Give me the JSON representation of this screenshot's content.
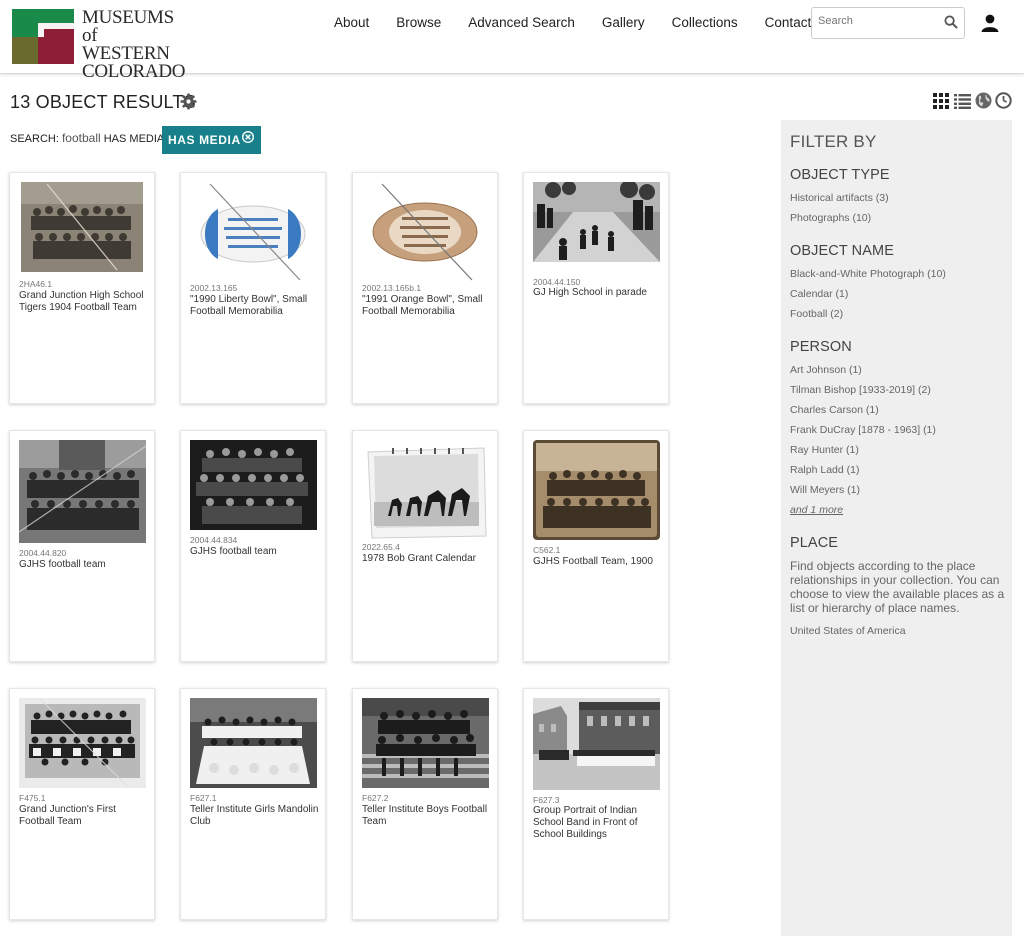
{
  "header": {
    "logo_lines": [
      "MUSEUMS",
      "of WESTERN",
      "COLORADO"
    ],
    "nav": [
      "About",
      "Browse",
      "Advanced Search",
      "Gallery",
      "Collections",
      "Contact"
    ],
    "search_placeholder": "Search",
    "colors": {
      "logo_green": "#1a8a4a",
      "logo_red": "#8e1d37",
      "logo_olive": "#6b6a2e"
    }
  },
  "results": {
    "title": "13 OBJECT RESULTS",
    "search_label": "SEARCH:",
    "search_term": "football",
    "media_label": "HAS MEDIA:",
    "chip_label": "HAS MEDIA",
    "chip_color": "#17808a"
  },
  "cards": [
    {
      "accession": "2HA46.1",
      "title": "Grand Junction High School Tigers 1904 Football Team",
      "image": "sepia-team-photo"
    },
    {
      "accession": "2002.13.165",
      "title": "\"1990 Liberty Bowl\", Small Football Memorabilia",
      "image": "white-football"
    },
    {
      "accession": "2002.13.165b.1",
      "title": "\"1991 Orange Bowl\", Small Football Memorabilia",
      "image": "tan-football"
    },
    {
      "accession": "2004.44.150",
      "title": "GJ High School in parade",
      "image": "bw-parade"
    },
    {
      "accession": "2004.44.820",
      "title": "GJHS football team",
      "image": "bw-team-photo"
    },
    {
      "accession": "2004.44.834",
      "title": "GJHS football team",
      "image": "bw-team-photo-dark"
    },
    {
      "accession": "2022.65.4",
      "title": "1978 Bob Grant Calendar",
      "image": "calendar-horses"
    },
    {
      "accession": "C562.1",
      "title": "GJHS Football Team, 1900",
      "image": "sepia-team-photo"
    },
    {
      "accession": "F475.1",
      "title": "Grand Junction's First Football Team",
      "image": "bw-team-photo"
    },
    {
      "accession": "F627.1",
      "title": "Teller Institute Girls Mandolin Club",
      "image": "bw-group-white-dresses"
    },
    {
      "accession": "F627.2",
      "title": "Teller Institute Boys Football Team",
      "image": "bw-team-on-steps"
    },
    {
      "accession": "F627.3",
      "title": "Group Portrait of Indian School Band in Front of School Buildings",
      "image": "bw-band-buildings"
    }
  ],
  "sidebar": {
    "title": "FILTER BY",
    "sections": [
      {
        "heading": "OBJECT TYPE",
        "items": [
          "Historical artifacts (3)",
          "Photographs (10)"
        ]
      },
      {
        "heading": "OBJECT NAME",
        "items": [
          "Black-and-White Photograph (10)",
          "Calendar (1)",
          "Football (2)"
        ]
      },
      {
        "heading": "PERSON",
        "items": [
          "Art Johnson (1)",
          "Tilman Bishop [1933-2019] (2)",
          "Charles Carson (1)",
          "Frank DuCray [1878 - 1963] (1)",
          "Ray Hunter (1)",
          "Ralph Ladd (1)",
          "Will Meyers (1)"
        ],
        "more": "and 1 more"
      },
      {
        "heading": "PLACE",
        "description": "Find objects according to the place relationships in your collection. You can choose to view the available places as a list or hierarchy of place names.",
        "items": [
          "United States of America"
        ]
      }
    ]
  },
  "icons": [
    "search-icon",
    "user-icon",
    "gear-icon",
    "grid-view-icon",
    "list-view-icon",
    "map-view-icon",
    "timeline-view-icon",
    "remove-filter-icon"
  ]
}
